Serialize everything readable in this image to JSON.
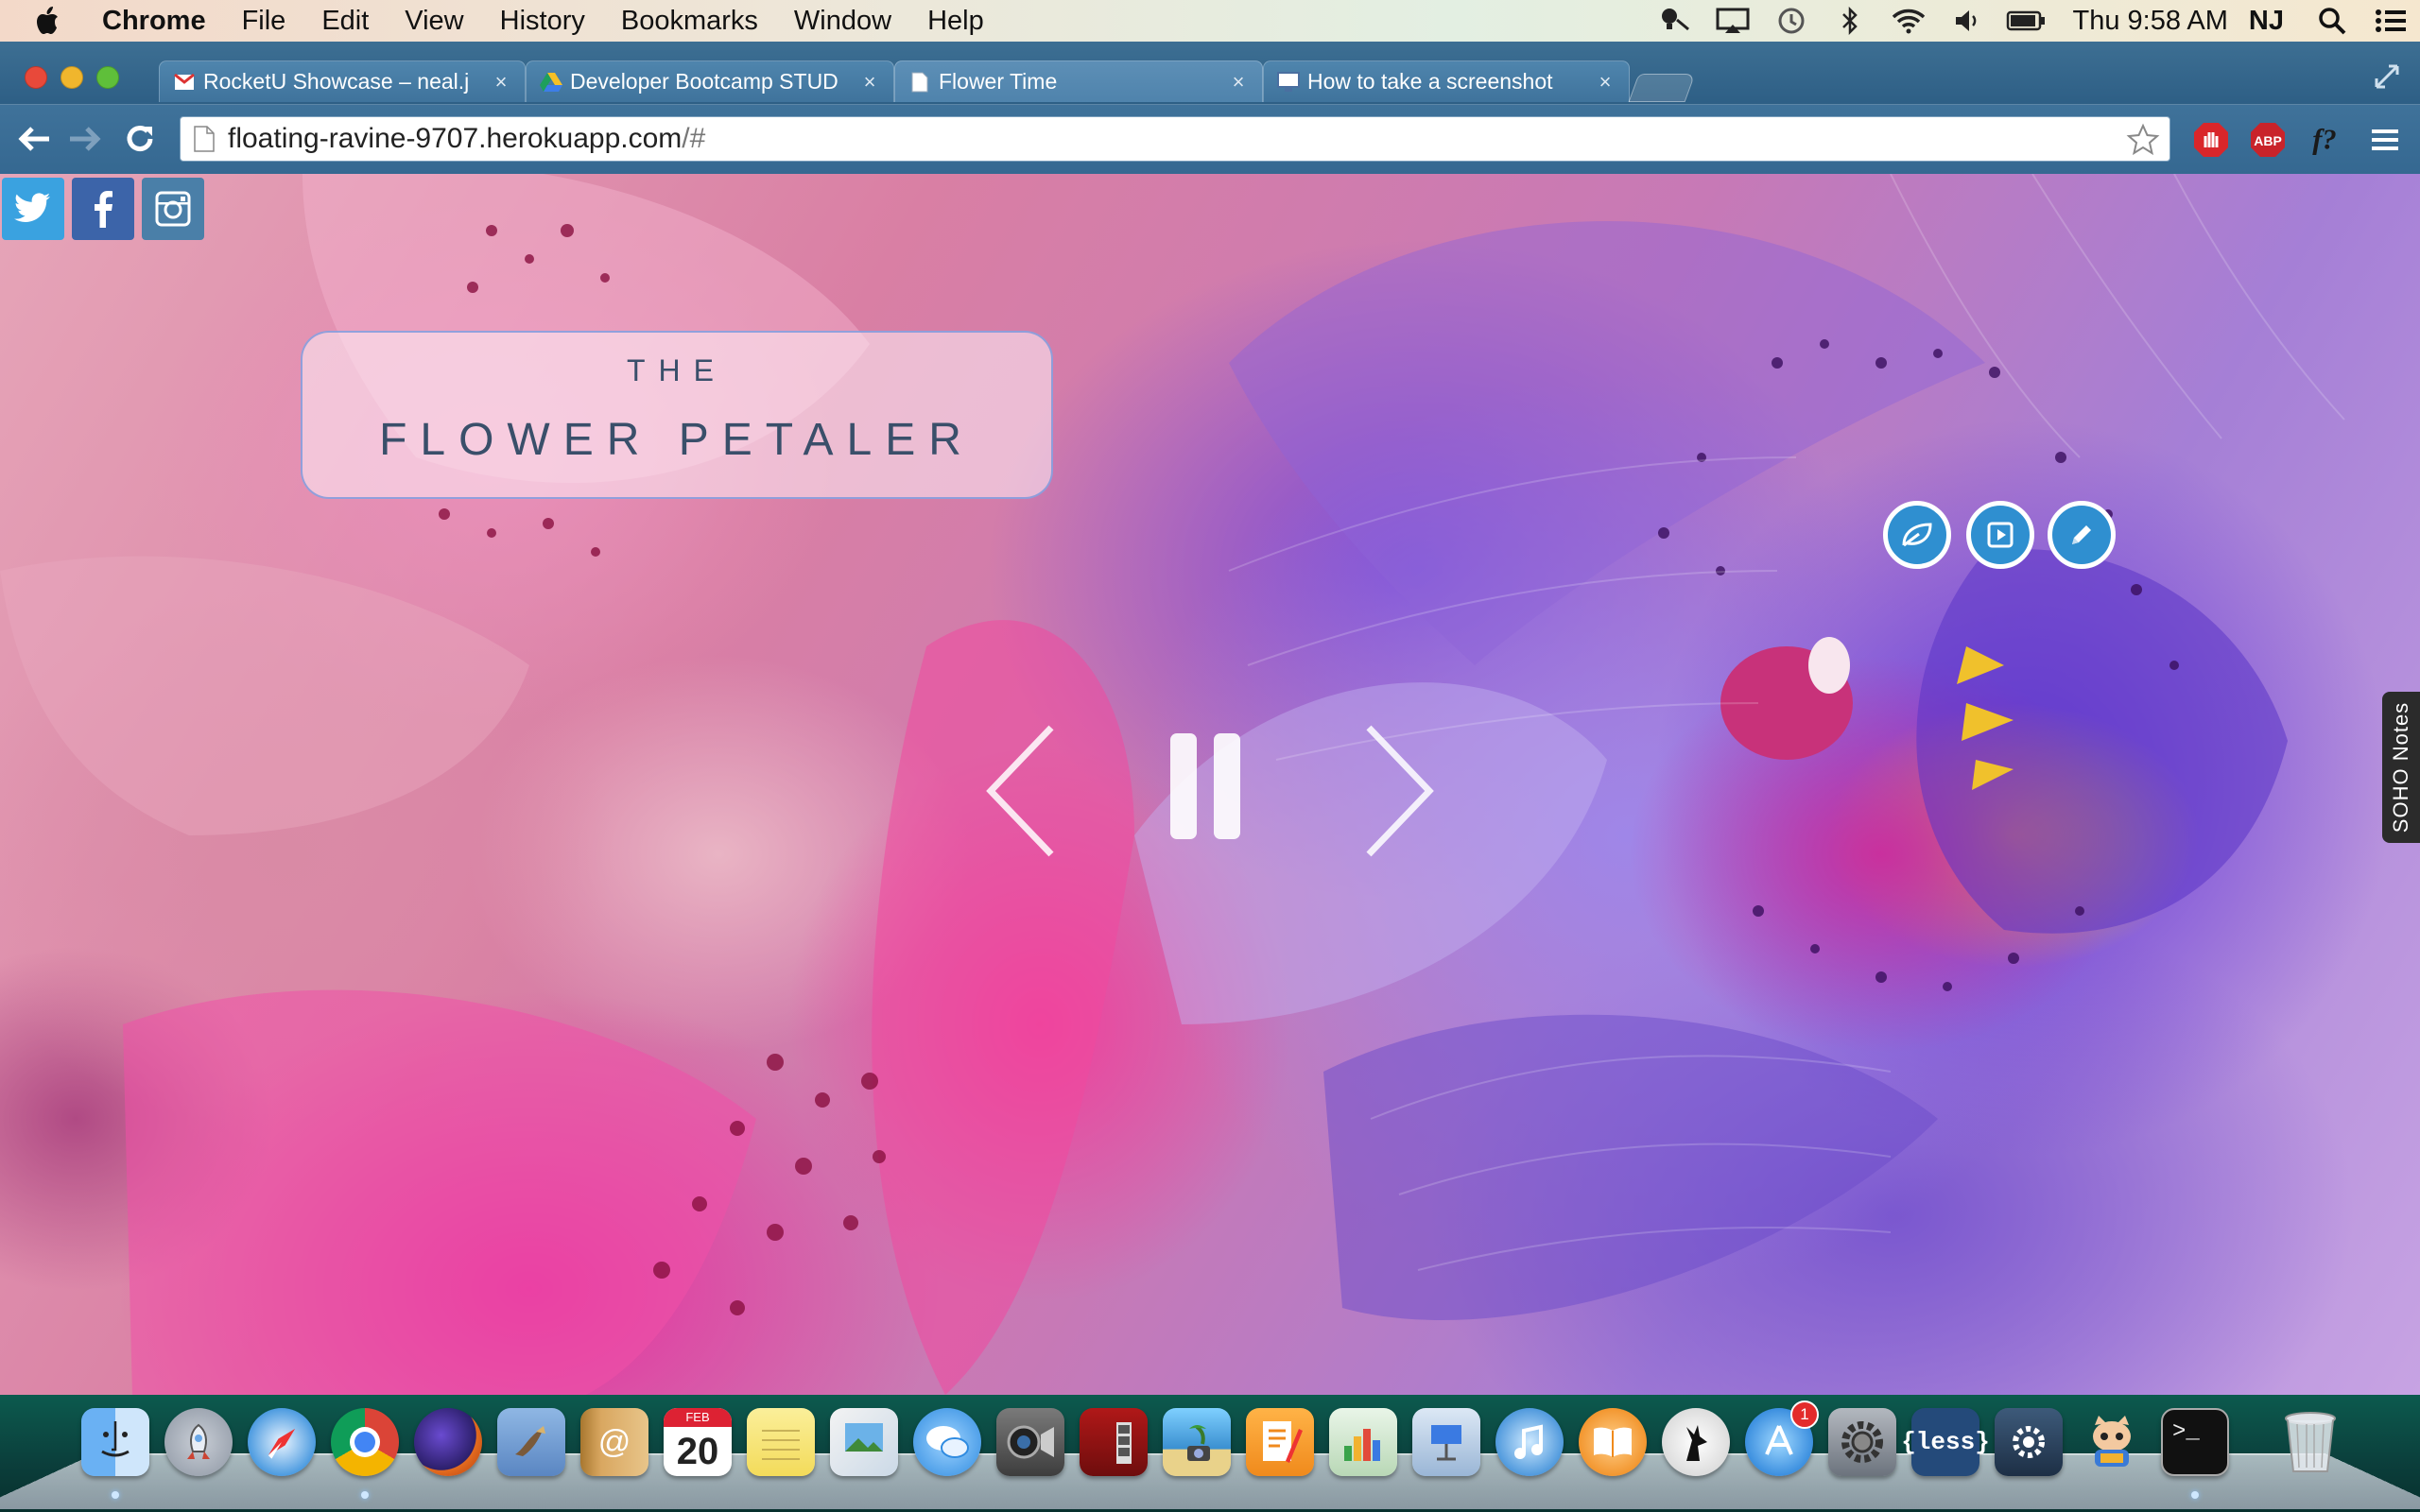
{
  "menubar": {
    "app_name": "Chrome",
    "items": [
      "File",
      "Edit",
      "View",
      "History",
      "Bookmarks",
      "Window",
      "Help"
    ],
    "clock": "Thu 9:58 AM",
    "user": "NJ"
  },
  "tabs": [
    {
      "title": "RocketU Showcase – neal.j",
      "favicon": "gmail-icon"
    },
    {
      "title": "Developer Bootcamp STUD",
      "favicon": "drive-icon"
    },
    {
      "title": "Flower Time",
      "favicon": "page-icon"
    },
    {
      "title": "How to take a screenshot",
      "favicon": "monitor-icon"
    }
  ],
  "toolbar": {
    "url_host": "floating-ravine-9707.herokuapp.com",
    "url_path": "/#",
    "extensions": [
      "adblock-hand-icon",
      "abp-icon",
      "fontface-ninja-icon"
    ],
    "ext_labels": {
      "abp": "ABP",
      "font": "f?"
    }
  },
  "page": {
    "title_small": "THE",
    "title_large": "FLOWER PETALER",
    "action_buttons": [
      "leaf-icon",
      "play-icon",
      "pencil-icon"
    ],
    "side_tab": "SOHO Notes",
    "social": [
      "twitter-icon",
      "facebook-icon",
      "instagram-icon"
    ]
  },
  "dock": {
    "apps": [
      "Finder",
      "Launchpad",
      "Safari",
      "Chrome",
      "Firefox",
      "Mail",
      "Contacts",
      "Calendar",
      "Notes",
      "Preview",
      "Messages",
      "FaceTime",
      "Photo Booth",
      "iPhoto",
      "Pages",
      "Numbers",
      "Keynote",
      "iTunes",
      "iBooks",
      "Growl",
      "App Store",
      "System Preferences",
      "LESS",
      "Gear App",
      "GitHub",
      "Terminal",
      "Trash"
    ],
    "calendar_month": "FEB",
    "calendar_day": "20",
    "app_store_badge": "1",
    "less_label": "{less}",
    "terminal_label": ">_"
  },
  "colors": {
    "menubar_bg": "#eee5d8",
    "chrome_frame": "#2b5c83",
    "accent_blue": "#2f8fd0",
    "twitter": "#3aa2e0",
    "facebook": "#3c64a9"
  }
}
